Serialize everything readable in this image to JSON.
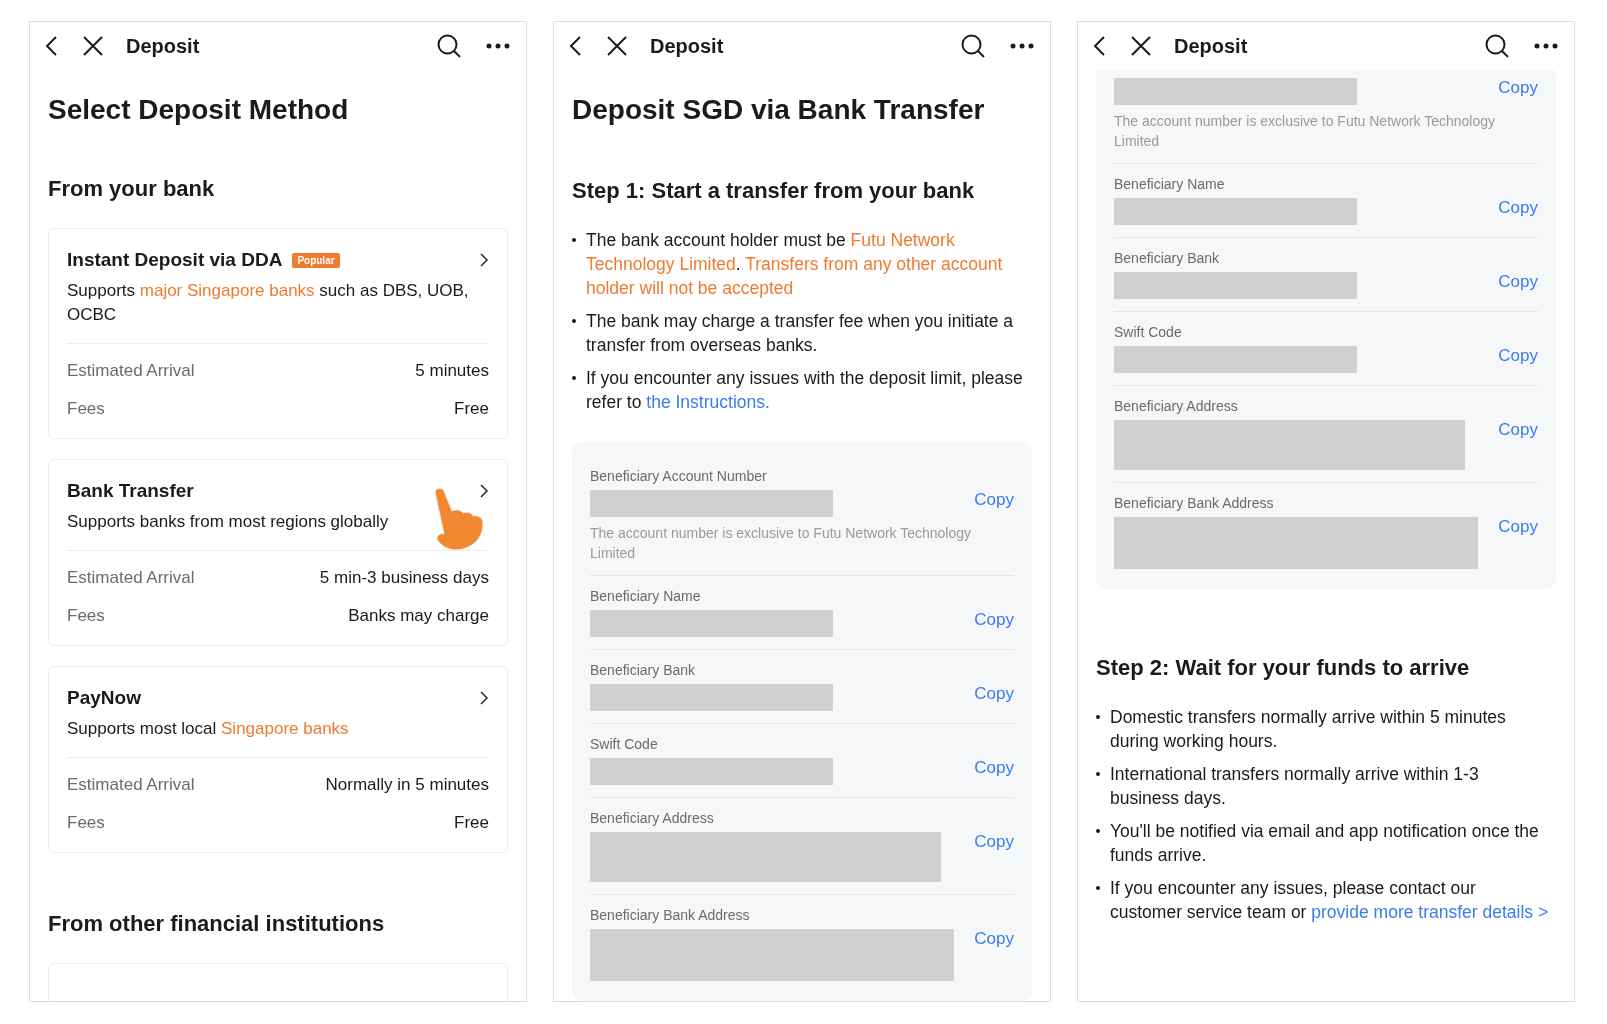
{
  "panels": [
    {
      "header": {
        "title": "Deposit"
      },
      "blocks": [
        {
          "kind": "title",
          "text": "Select Deposit Method"
        },
        {
          "kind": "subtitle",
          "text": "From your bank"
        },
        {
          "kind": "method",
          "name": "Instant Deposit via DDA",
          "badge": "Popular",
          "description": [
            {
              "kind": "text",
              "text": "Supports "
            },
            {
              "kind": "highlight",
              "text": "major Singapore banks"
            },
            {
              "kind": "text",
              "text": " such as DBS, UOB, OCBC"
            }
          ],
          "details": [
            {
              "label": "Estimated Arrival",
              "value": "5 minutes"
            },
            {
              "label": "Fees",
              "value": "Free"
            }
          ]
        },
        {
          "kind": "method",
          "name": "Bank Transfer",
          "pointer": true,
          "description": [
            {
              "kind": "text",
              "text": "Supports banks from most regions globally"
            }
          ],
          "details": [
            {
              "label": "Estimated Arrival",
              "value": "5 min-3 business days"
            },
            {
              "label": "Fees",
              "value": "Banks may charge"
            }
          ]
        },
        {
          "kind": "method",
          "name": "PayNow",
          "description": [
            {
              "kind": "text",
              "text": "Supports most local "
            },
            {
              "kind": "highlight",
              "text": "Singapore banks"
            }
          ],
          "details": [
            {
              "label": "Estimated Arrival",
              "value": "Normally in 5 minutes"
            },
            {
              "label": "Fees",
              "value": "Free"
            }
          ]
        },
        {
          "kind": "subtitle",
          "text": "From other financial institutions"
        },
        {
          "kind": "method_cut"
        }
      ]
    },
    {
      "header": {
        "title": "Deposit"
      },
      "blocks": [
        {
          "kind": "title",
          "text": "Deposit SGD via Bank Transfer"
        },
        {
          "kind": "step",
          "text": "Step 1: Start a transfer from your bank"
        },
        {
          "kind": "bullets",
          "items": [
            [
              {
                "kind": "text",
                "text": "The bank account holder must be "
              },
              {
                "kind": "highlight",
                "text": "Futu Network Technology Limited"
              },
              {
                "kind": "text",
                "text": ". "
              },
              {
                "kind": "highlight",
                "text": "Transfers from any other account holder will not be accepted"
              }
            ],
            [
              {
                "kind": "text",
                "text": "The bank may charge a transfer fee when you initiate a transfer from overseas banks."
              }
            ],
            [
              {
                "kind": "text",
                "text": "If you encounter any issues with the deposit limit, please refer to "
              },
              {
                "kind": "link",
                "text": "the Instructions."
              }
            ]
          ]
        },
        {
          "kind": "fields",
          "items": [
            {
              "label": "Beneficiary Account Number",
              "kind": "line",
              "copy": "Copy",
              "note": "The account number is exclusive to Futu Network Technology Limited"
            },
            {
              "label": "Beneficiary Name",
              "kind": "line",
              "copy": "Copy"
            },
            {
              "label": "Beneficiary Bank",
              "kind": "line",
              "copy": "Copy"
            },
            {
              "label": "Swift Code",
              "kind": "line",
              "copy": "Copy"
            },
            {
              "label": "Beneficiary Address",
              "kind": "block",
              "copy": "Copy"
            },
            {
              "label": "Beneficiary Bank Address",
              "kind": "block-wide",
              "copy": "Copy"
            }
          ]
        }
      ]
    },
    {
      "header": {
        "title": "Deposit"
      },
      "blocks": [
        {
          "kind": "fields",
          "continued": true,
          "items": [
            {
              "kind": "line",
              "copy": "Copy",
              "note": "The account number is exclusive to Futu Network Technology Limited"
            },
            {
              "label": "Beneficiary Name",
              "kind": "line",
              "copy": "Copy"
            },
            {
              "label": "Beneficiary Bank",
              "kind": "line",
              "copy": "Copy"
            },
            {
              "label": "Swift Code",
              "kind": "line",
              "copy": "Copy"
            },
            {
              "label": "Beneficiary Address",
              "kind": "block",
              "copy": "Copy"
            },
            {
              "label": "Beneficiary Bank Address",
              "kind": "block-wide",
              "copy": "Copy"
            }
          ]
        },
        {
          "kind": "step",
          "text": "Step 2: Wait for your funds to arrive"
        },
        {
          "kind": "bullets",
          "items": [
            [
              {
                "kind": "text",
                "text": "Domestic transfers normally arrive within 5 minutes during working hours."
              }
            ],
            [
              {
                "kind": "text",
                "text": "International transfers normally arrive within 1-3 business days."
              }
            ],
            [
              {
                "kind": "text",
                "text": "You'll be notified via email and app notification once the funds arrive."
              }
            ],
            [
              {
                "kind": "text",
                "text": "If you encounter any issues, please contact our customer service team or "
              },
              {
                "kind": "link",
                "text": "provide more transfer details >"
              }
            ]
          ]
        }
      ]
    }
  ]
}
